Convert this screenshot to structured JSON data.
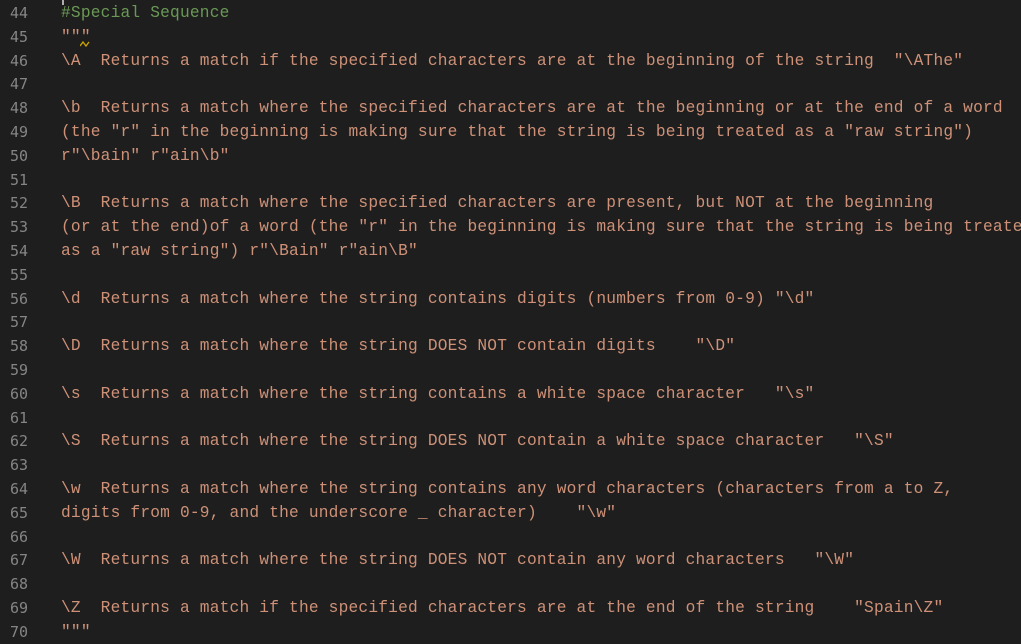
{
  "editor": {
    "lines": [
      {
        "num": "44",
        "text": "#Special Sequence",
        "kind": "comment"
      },
      {
        "num": "45",
        "text": "\"\"\"",
        "kind": "string"
      },
      {
        "num": "46",
        "text": "\\A  Returns a match if the specified characters are at the beginning of the string  \"\\AThe\"",
        "kind": "string"
      },
      {
        "num": "47",
        "text": "",
        "kind": "string"
      },
      {
        "num": "48",
        "text": "\\b  Returns a match where the specified characters are at the beginning or at the end of a word",
        "kind": "string"
      },
      {
        "num": "49",
        "text": "(the \"r\" in the beginning is making sure that the string is being treated as a \"raw string\")",
        "kind": "string"
      },
      {
        "num": "50",
        "text": "r\"\\bain\" r\"ain\\b\"",
        "kind": "string"
      },
      {
        "num": "51",
        "text": "",
        "kind": "string"
      },
      {
        "num": "52",
        "text": "\\B  Returns a match where the specified characters are present, but NOT at the beginning",
        "kind": "string"
      },
      {
        "num": "53",
        "text": "(or at the end)of a word (the \"r\" in the beginning is making sure that the string is being treated",
        "kind": "string"
      },
      {
        "num": "54",
        "text": "as a \"raw string\") r\"\\Bain\" r\"ain\\B\"",
        "kind": "string"
      },
      {
        "num": "55",
        "text": "",
        "kind": "string"
      },
      {
        "num": "56",
        "text": "\\d  Returns a match where the string contains digits (numbers from 0-9) \"\\d\"",
        "kind": "string"
      },
      {
        "num": "57",
        "text": "",
        "kind": "string"
      },
      {
        "num": "58",
        "text": "\\D  Returns a match where the string DOES NOT contain digits    \"\\D\"",
        "kind": "string"
      },
      {
        "num": "59",
        "text": "",
        "kind": "string"
      },
      {
        "num": "60",
        "text": "\\s  Returns a match where the string contains a white space character   \"\\s\"",
        "kind": "string"
      },
      {
        "num": "61",
        "text": "",
        "kind": "string"
      },
      {
        "num": "62",
        "text": "\\S  Returns a match where the string DOES NOT contain a white space character   \"\\S\"",
        "kind": "string"
      },
      {
        "num": "63",
        "text": "",
        "kind": "string"
      },
      {
        "num": "64",
        "text": "\\w  Returns a match where the string contains any word characters (characters from a to Z,",
        "kind": "string"
      },
      {
        "num": "65",
        "text": "digits from 0-9, and the underscore _ character)    \"\\w\"",
        "kind": "string"
      },
      {
        "num": "66",
        "text": "",
        "kind": "string"
      },
      {
        "num": "67",
        "text": "\\W  Returns a match where the string DOES NOT contain any word characters   \"\\W\"",
        "kind": "string"
      },
      {
        "num": "68",
        "text": "",
        "kind": "string"
      },
      {
        "num": "69",
        "text": "\\Z  Returns a match if the specified characters are at the end of the string    \"Spain\\Z\"",
        "kind": "string"
      },
      {
        "num": "70",
        "text": "\"\"\"",
        "kind": "string"
      }
    ],
    "colors": {
      "background": "#1e1e1e",
      "line_number": "#858585",
      "string": "#ce9178",
      "comment": "#6a9955",
      "warning_squiggle": "#cca700"
    }
  }
}
